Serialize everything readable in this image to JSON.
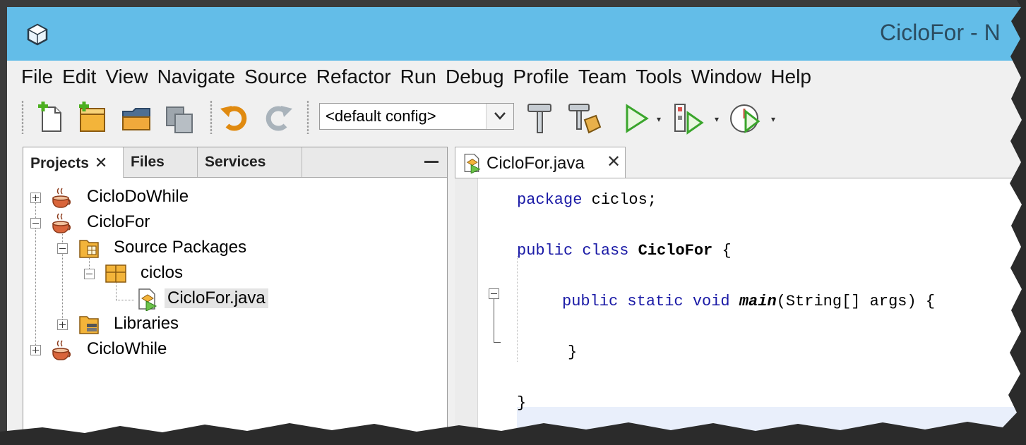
{
  "window": {
    "title": "CicloFor - N",
    "title_bar_color": "#63bde8"
  },
  "menubar": {
    "items": [
      "File",
      "Edit",
      "View",
      "Navigate",
      "Source",
      "Refactor",
      "Run",
      "Debug",
      "Profile",
      "Team",
      "Tools",
      "Window",
      "Help"
    ]
  },
  "toolbar": {
    "config_value": "<default config>",
    "icons": [
      "new-file-icon",
      "new-project-icon",
      "open-project-icon",
      "close-project-icon",
      "undo-icon",
      "redo-icon",
      "build-hammer-icon",
      "clean-build-icon",
      "run-icon",
      "debug-icon",
      "profile-icon"
    ]
  },
  "projects_panel": {
    "tabs": [
      {
        "label": "Projects",
        "active": true
      },
      {
        "label": "Files",
        "active": false
      },
      {
        "label": "Services",
        "active": false
      }
    ],
    "close_glyph": "✕",
    "tree": [
      {
        "label": "CicloDoWhile",
        "icon": "java-project-icon",
        "expanded": false
      },
      {
        "label": "CicloFor",
        "icon": "java-project-icon",
        "expanded": true
      },
      {
        "label": "Source Packages",
        "icon": "source-packages-icon",
        "expanded": true
      },
      {
        "label": "ciclos",
        "icon": "package-icon",
        "expanded": true
      },
      {
        "label": "CicloFor.java",
        "icon": "java-file-icon",
        "selected": true
      },
      {
        "label": "Libraries",
        "icon": "libraries-icon",
        "expanded": false
      },
      {
        "label": "CicloWhile",
        "icon": "java-project-icon",
        "expanded": false
      }
    ]
  },
  "editor": {
    "tab_label": "CicloFor.java",
    "close_glyph": "✕",
    "keyword_color": "#1a1aa6",
    "code": {
      "l1_kw": "package",
      "l1_rest": " ciclos;",
      "l2_kw": "public class",
      "l2_name": "CicloFor",
      "l2_rest": " {",
      "l3_kw": "public static void",
      "l3_name": "main",
      "l3_rest": "(String[] args) {",
      "l4": "}",
      "l5": "}"
    }
  }
}
